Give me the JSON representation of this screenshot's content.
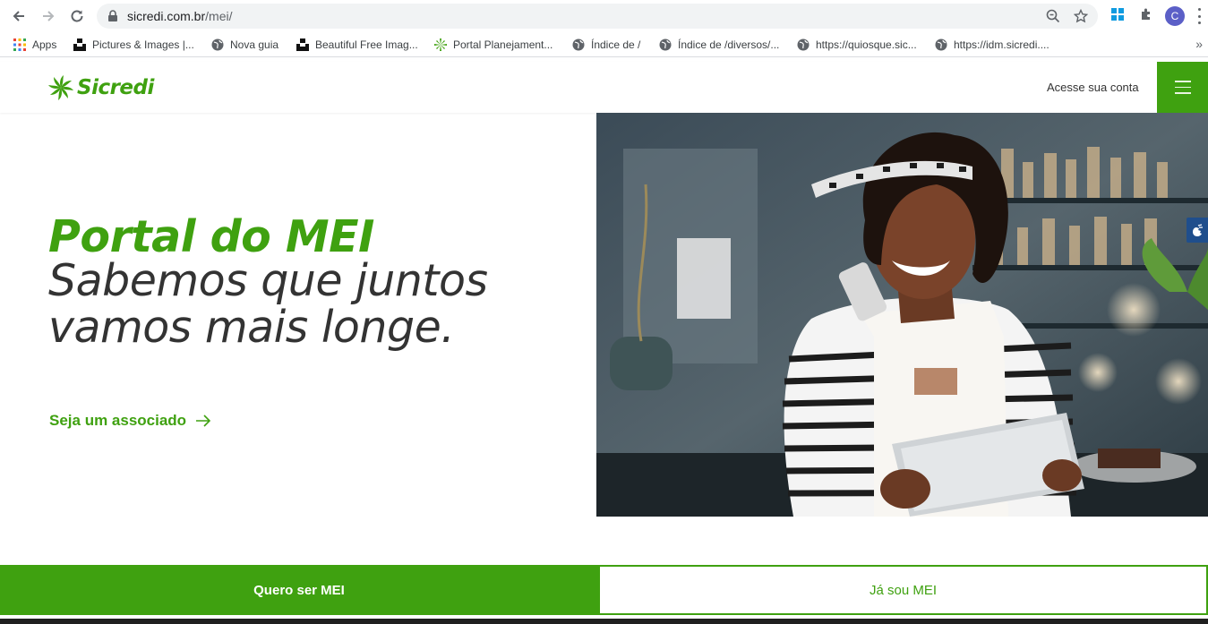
{
  "browser": {
    "url_host": "sicredi.com.br",
    "url_path": "/mei/",
    "profile_initial": "C"
  },
  "bookmarks": [
    {
      "label": "Apps",
      "icon": "apps-grid-icon"
    },
    {
      "label": "Pictures & Images |...",
      "icon": "unsplash-icon"
    },
    {
      "label": "Nova guia",
      "icon": "globe-icon"
    },
    {
      "label": "Beautiful Free Imag...",
      "icon": "unsplash-icon"
    },
    {
      "label": "Portal Planejament...",
      "icon": "sicredi-icon"
    },
    {
      "label": "Índice de /",
      "icon": "globe-icon"
    },
    {
      "label": "Índice de /diversos/...",
      "icon": "globe-icon"
    },
    {
      "label": "https://quiosque.sic...",
      "icon": "globe-icon"
    },
    {
      "label": "https://idm.sicredi....",
      "icon": "globe-icon"
    }
  ],
  "header": {
    "logo_text": "Sicredi",
    "account_link": "Acesse sua conta"
  },
  "hero": {
    "title": "Portal do MEI",
    "subtitle_line1": "Sabemos que juntos",
    "subtitle_line2": "vamos mais longe.",
    "cta": "Seja um associado"
  },
  "tabs": [
    {
      "label": "Quero ser MEI",
      "active": true
    },
    {
      "label": "Já sou MEI",
      "active": false
    }
  ],
  "colors": {
    "brand_green": "#3fa110",
    "text_dark": "#333333",
    "accessibility_blue": "#1f4e8c"
  }
}
